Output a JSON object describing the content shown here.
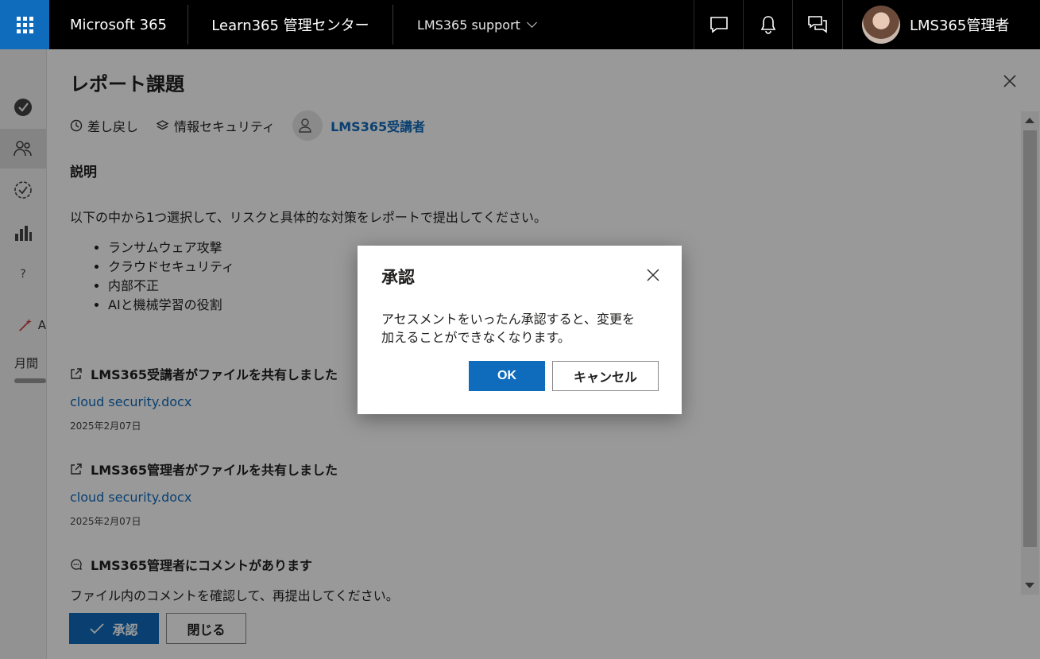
{
  "topbar": {
    "brand": "Microsoft 365",
    "center_name": "Learn365 管理センター",
    "tenant": "LMS365 support",
    "user_name": "LMS365管理者"
  },
  "sidebar": {
    "items": [
      {
        "icon": "check-circle-icon"
      },
      {
        "icon": "people-icon"
      },
      {
        "icon": "badge-icon"
      },
      {
        "icon": "bar-chart-icon"
      },
      {
        "icon": "help-icon",
        "glyph": "?"
      },
      {
        "icon": "magic-wand-icon",
        "label": "A"
      }
    ],
    "truncated_text": "月間",
    "usage_fraction": 1.0
  },
  "panel": {
    "title": "レポート課題",
    "status": "差し戻し",
    "category": "情報セキュリティ",
    "learner": "LMS365受講者",
    "description_heading": "説明",
    "description": "以下の中から1つ選択して、リスクと具体的な対策をレポートで提出してください。",
    "bullets": [
      "ランサムウェア攻撃",
      "クラウドセキュリティ",
      "内部不正",
      "AIと機械学習の役割"
    ],
    "activities": [
      {
        "heading": "LMS365受講者がファイルを共有しました",
        "file": "cloud security.docx",
        "date": "2025年2月07日"
      },
      {
        "heading": "LMS365管理者がファイルを共有しました",
        "file": "cloud security.docx",
        "date": "2025年2月07日"
      }
    ],
    "comment": {
      "heading": "LMS365管理者にコメントがあります",
      "text": "ファイル内のコメントを確認して、再提出してください。"
    },
    "approve_label": "承認",
    "close_label": "閉じる"
  },
  "dialog": {
    "title": "承認",
    "message_line1": "アセスメントをいったん承認すると、変更を",
    "message_line2": "加えることができなくなります。",
    "ok_label": "OK",
    "cancel_label": "キャンセル"
  },
  "colors": {
    "accent": "#0f6cbd",
    "topbar_bg": "#000000",
    "overlay": "rgba(0,0,0,0.4)"
  }
}
